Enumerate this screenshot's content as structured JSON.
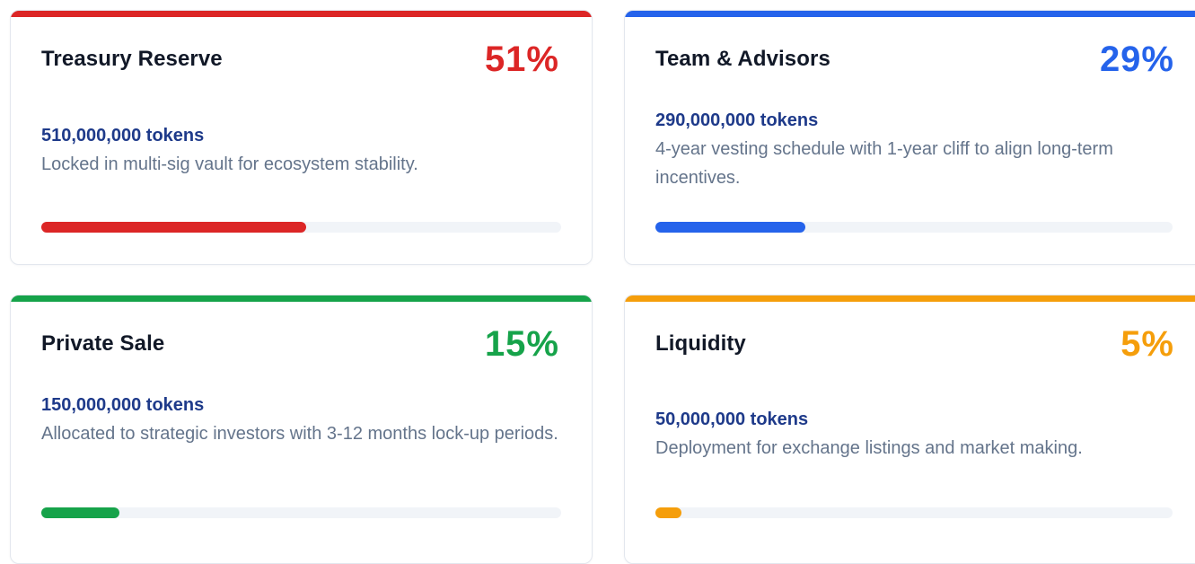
{
  "allocations": [
    {
      "title": "Treasury Reserve",
      "percent_label": "51%",
      "percent": 51,
      "tokens": "510,000,000 tokens",
      "description": "Locked in multi-sig vault for ecosystem stability.",
      "color": "#dc2626"
    },
    {
      "title": "Team & Advisors",
      "percent_label": "29%",
      "percent": 29,
      "tokens": "290,000,000 tokens",
      "description": "4-year vesting schedule with 1-year cliff to align long-term incentives.",
      "color": "#2563eb"
    },
    {
      "title": "Private Sale",
      "percent_label": "15%",
      "percent": 15,
      "tokens": "150,000,000 tokens",
      "description": "Allocated to strategic investors with 3-12 months lock-up periods.",
      "color": "#16a34a"
    },
    {
      "title": "Liquidity",
      "percent_label": "5%",
      "percent": 5,
      "tokens": "50,000,000 tokens",
      "description": "Deployment for exchange listings and market making.",
      "color": "#f59e0b"
    }
  ]
}
